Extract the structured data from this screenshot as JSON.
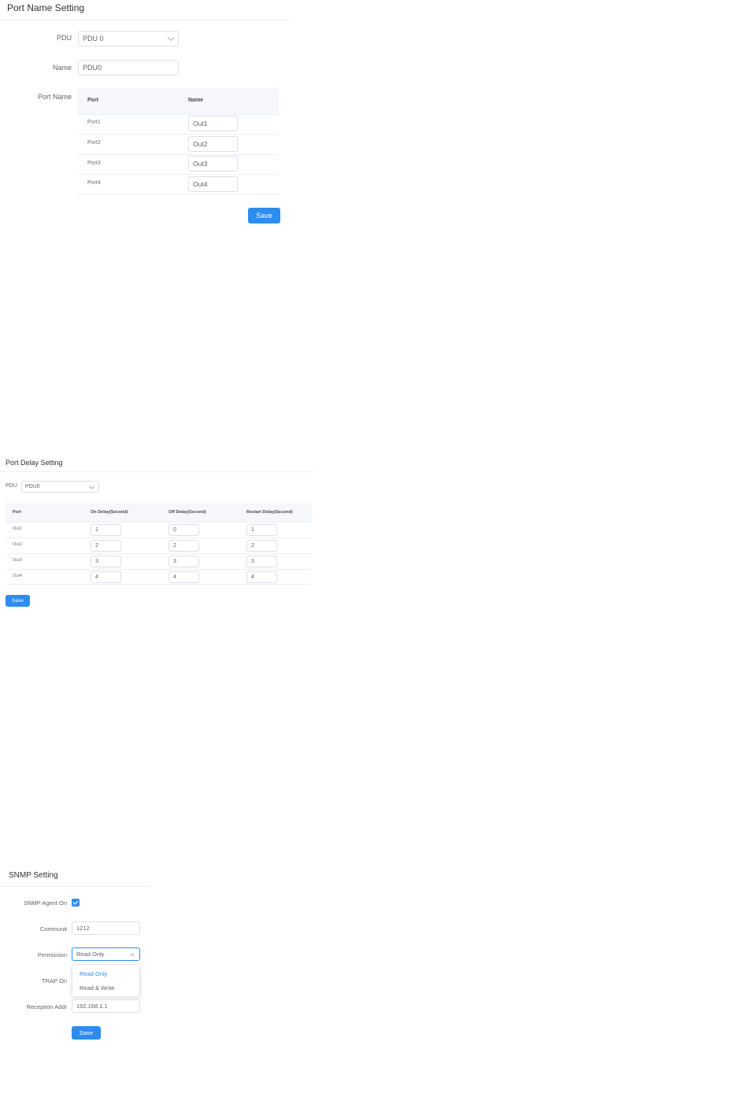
{
  "port_name_setting": {
    "title": "Port Name Setting",
    "pdu_label": "PDU",
    "pdu_value": "PDU 0",
    "name_label": "Name",
    "name_value": "PDU0",
    "port_name_label": "Port Name",
    "table": {
      "headers": [
        "Port",
        "Name"
      ],
      "rows": [
        {
          "port": "Port1",
          "name": "Out1"
        },
        {
          "port": "Port2",
          "name": "Out2"
        },
        {
          "port": "Port3",
          "name": "Out3"
        },
        {
          "port": "Port4",
          "name": "Out4"
        }
      ]
    },
    "save_label": "Save"
  },
  "port_delay_setting": {
    "title": "Port Delay Setting",
    "pdu_label": "PDU",
    "pdu_value": "PDU0",
    "table": {
      "headers": [
        "Port",
        "On Delay(Second)",
        "Off Delay(Second)",
        "Restart Delay(Second)"
      ],
      "rows": [
        {
          "port": "Out1",
          "on": "1",
          "off": "0",
          "restart": "1"
        },
        {
          "port": "Out2",
          "on": "2",
          "off": "2",
          "restart": "2"
        },
        {
          "port": "Out3",
          "on": "3",
          "off": "3",
          "restart": "3"
        },
        {
          "port": "Out4",
          "on": "4",
          "off": "4",
          "restart": "4"
        }
      ]
    },
    "save_label": "Save"
  },
  "snmp_setting": {
    "title": "SNMP Setting",
    "agent_label": "SNMP Agent On",
    "agent_checked": true,
    "community_label": "Communit",
    "community_value": "1212",
    "permission_label": "Permission",
    "permission_value": "Read Only",
    "permission_options": [
      "Read Only",
      "Read & Write"
    ],
    "trap_label": "TRAP On",
    "reception_label": "Reception Addr",
    "reception_value": "192.168.1.1",
    "save_label": "Save"
  },
  "colors": {
    "primary": "#2d8cf0",
    "border": "#dcdfe6",
    "header_bg": "#f5f7fa"
  }
}
